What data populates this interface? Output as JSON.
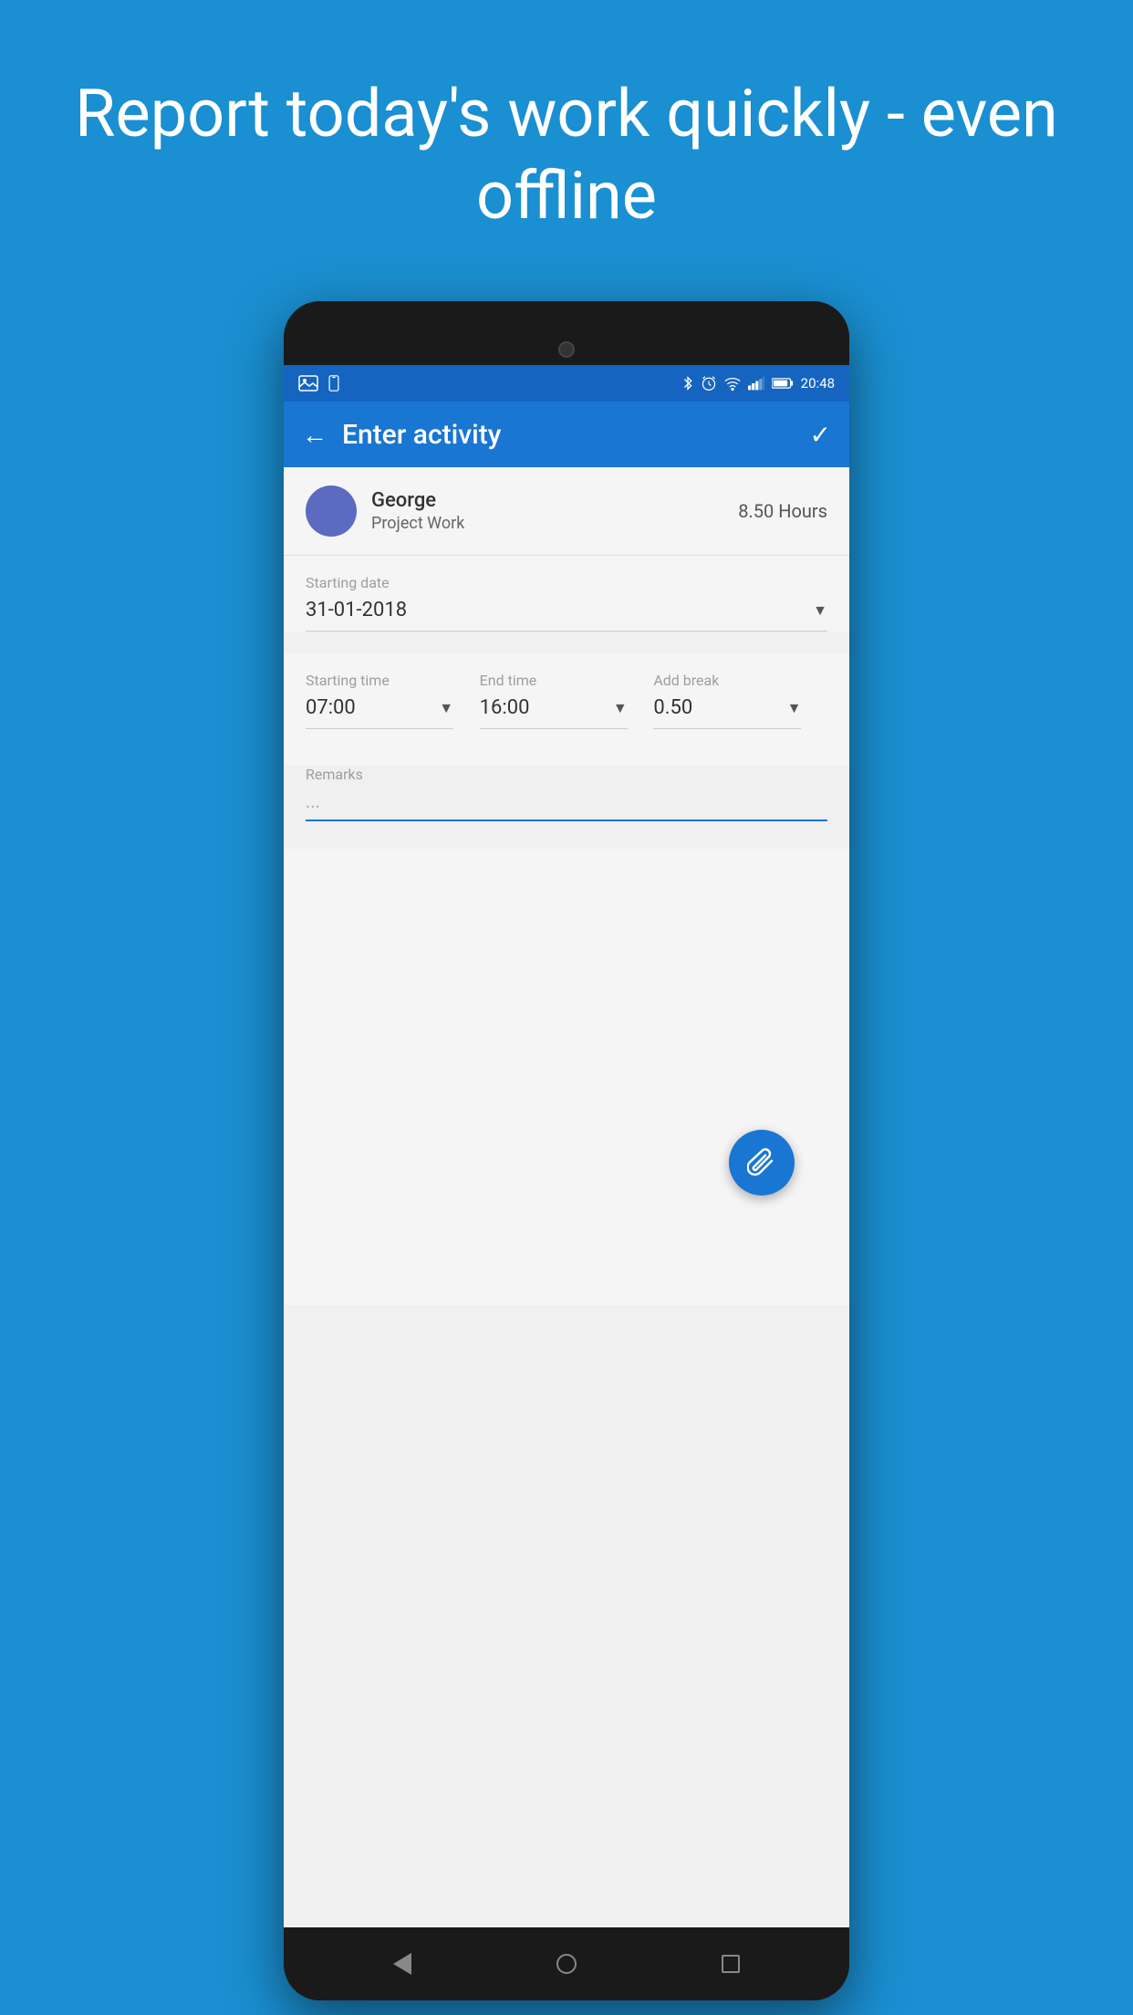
{
  "page": {
    "background_color": "#1a8fd1",
    "headline": "Report today's work quickly - even offline"
  },
  "status_bar": {
    "time": "20:48",
    "icons": [
      "image",
      "phone",
      "bluetooth",
      "alarm",
      "wifi",
      "signal",
      "battery"
    ]
  },
  "app_bar": {
    "title": "Enter activity",
    "back_label": "←",
    "confirm_label": "✓"
  },
  "user": {
    "name": "George",
    "project": "Project Work",
    "hours": "8.50 Hours"
  },
  "form": {
    "starting_date_label": "Starting date",
    "starting_date_value": "31-01-2018",
    "starting_time_label": "Starting time",
    "starting_time_value": "07:00",
    "end_time_label": "End time",
    "end_time_value": "16:00",
    "add_break_label": "Add break",
    "add_break_value": "0.50",
    "remarks_label": "Remarks",
    "remarks_placeholder": "..."
  },
  "fab": {
    "icon": "📎"
  }
}
